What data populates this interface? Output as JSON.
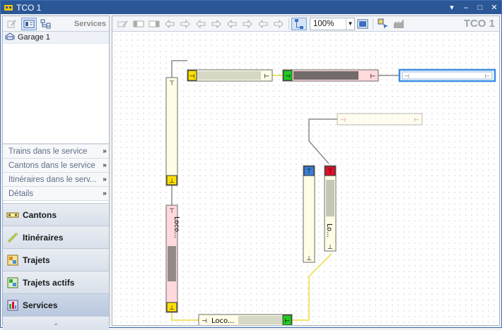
{
  "window": {
    "title": "TCO 1"
  },
  "sidebar": {
    "header": "Services",
    "tree": [
      {
        "label": "Garage 1"
      }
    ],
    "sections": [
      {
        "label": "Trains dans le service"
      },
      {
        "label": "Cantons dans le service"
      },
      {
        "label": "Itinéraires dans le serv..."
      },
      {
        "label": "Détails"
      }
    ],
    "nav": [
      {
        "label": "Cantons",
        "icon": "cantons-icon"
      },
      {
        "label": "Itinéraires",
        "icon": "itineraires-icon"
      },
      {
        "label": "Trajets",
        "icon": "trajets-icon"
      },
      {
        "label": "Trajets actifs",
        "icon": "trajets-actifs-icon"
      },
      {
        "label": "Services",
        "icon": "services-icon"
      }
    ],
    "footer_glyph": "⌄"
  },
  "main": {
    "title": "TCO 1",
    "zoom": "100%",
    "blocks": [
      {
        "label": ""
      },
      {
        "label": ""
      },
      {
        "label": ""
      },
      {
        "label": ""
      },
      {
        "label": ""
      },
      {
        "label": "Loco..."
      },
      {
        "label": ""
      },
      {
        "label": "Lo..."
      },
      {
        "label": "Loco..."
      }
    ]
  },
  "colors": {
    "titlebar": "#2b5797",
    "track": "#8c8c8c",
    "active_track": "#f2e36a",
    "block_fill": "#fffde6",
    "occupied_fill": "#ffd9db",
    "signal_yellow": "#ffe000",
    "signal_green": "#22cc22",
    "signal_red": "#e0102a",
    "signal_blue": "#3a7fd5",
    "selection": "#3a8ee6"
  }
}
